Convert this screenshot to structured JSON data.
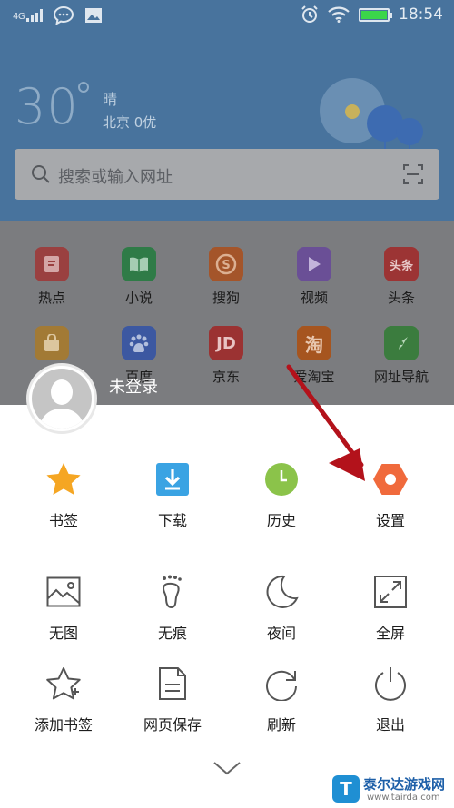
{
  "status_bar": {
    "network": "4G",
    "time": "18:54",
    "icons": [
      "signal-icon",
      "chat-bubble-icon",
      "image-icon",
      "alarm-icon",
      "wifi-icon",
      "battery-icon"
    ]
  },
  "weather": {
    "temperature": "30",
    "condition": "晴",
    "location_aqi": "北京 0优"
  },
  "search": {
    "placeholder": "搜索或输入网址"
  },
  "apps": [
    {
      "label": "热点",
      "color": "#9a4040",
      "icon": "hot-icon"
    },
    {
      "label": "小说",
      "color": "#2f7b47",
      "icon": "book-icon"
    },
    {
      "label": "搜狗",
      "color": "#a4552a",
      "icon": "sogou-icon"
    },
    {
      "label": "视频",
      "color": "#6a4f96",
      "icon": "video-icon"
    },
    {
      "label": "头条",
      "color": "#9c3434",
      "icon": "toutiao-icon"
    },
    {
      "label": "",
      "color": "#a27a35",
      "icon": "shopping-bag-icon"
    },
    {
      "label": "百度",
      "color": "#3c58a1",
      "icon": "baidu-icon"
    },
    {
      "label": "京东",
      "color": "#9b3232",
      "icon": "jd-icon"
    },
    {
      "label": "爱淘宝",
      "color": "#a6551f",
      "icon": "taobao-icon"
    },
    {
      "label": "网址导航",
      "color": "#3b7c3e",
      "icon": "compass-icon"
    }
  ],
  "user": {
    "name": "未登录"
  },
  "menu": {
    "primary": [
      {
        "label": "书签",
        "icon": "star-icon"
      },
      {
        "label": "下载",
        "icon": "download-icon"
      },
      {
        "label": "历史",
        "icon": "clock-icon"
      },
      {
        "label": "设置",
        "icon": "settings-icon"
      }
    ],
    "secondary": [
      {
        "label": "无图",
        "icon": "image-off-icon"
      },
      {
        "label": "无痕",
        "icon": "footprint-icon"
      },
      {
        "label": "夜间",
        "icon": "moon-icon"
      },
      {
        "label": "全屏",
        "icon": "fullscreen-icon"
      },
      {
        "label": "添加书签",
        "icon": "add-bookmark-icon"
      },
      {
        "label": "网页保存",
        "icon": "save-page-icon"
      },
      {
        "label": "刷新",
        "icon": "refresh-icon"
      },
      {
        "label": "退出",
        "icon": "power-icon"
      }
    ]
  },
  "watermark": {
    "logo": "T",
    "name": "泰尔达游戏网",
    "url": "www.tairda.com"
  },
  "colors": {
    "header_blue": "#48739d",
    "annotation_arrow": "#b3121b",
    "settings_orange": "#f06a3c",
    "bookmark_star": "#f5a623",
    "download_blue": "#3aa3e3",
    "history_green": "#8bc34a"
  }
}
